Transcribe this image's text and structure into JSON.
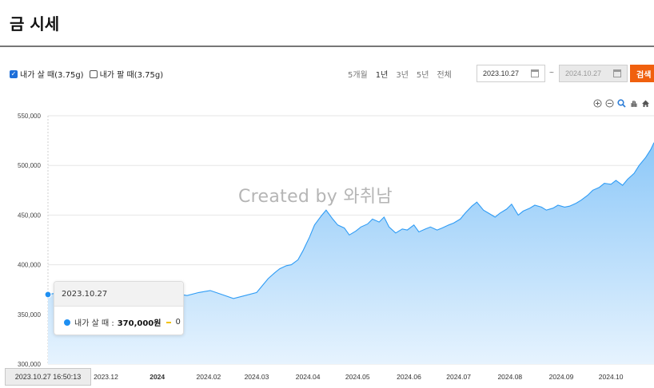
{
  "page": {
    "title": "금 시세"
  },
  "filters": {
    "buy_checkbox": {
      "label": "내가 살 때(3.75g)",
      "checked": true
    },
    "sell_checkbox": {
      "label": "내가 팔 때(3.75g)",
      "checked": false
    },
    "periods": [
      "5개월",
      "1년",
      "3년",
      "5년",
      "전체"
    ],
    "active_period": "1년",
    "start_date": "2023.10.27",
    "end_date": "2024.10.27",
    "tilde": "~",
    "search_label": "검색"
  },
  "toolbar_icons": [
    "zoom-in-icon",
    "zoom-out-icon",
    "magnify-icon",
    "pan-hand-icon",
    "home-icon"
  ],
  "watermark": "Created by 와취남",
  "tooltip": {
    "date": "2023.10.27",
    "series_label": "내가 살 때 :",
    "value": "370,000원",
    "secondary_value": "0"
  },
  "x_hover_label": "2023.10.27 16:50:13",
  "colors": {
    "line": "#2f9cf5",
    "area_top": "#8dc8f8",
    "area_bottom": "#e6f3fe",
    "accent": "#f0600e",
    "checkbox": "#1e6fd9"
  },
  "chart_data": {
    "type": "area",
    "title": "",
    "xlabel": "",
    "ylabel": "",
    "ylim": [
      300000,
      550000
    ],
    "y_ticks": [
      300000,
      350000,
      400000,
      450000,
      500000,
      550000
    ],
    "y_tick_labels": [
      "300,000",
      "350,000",
      "400,000",
      "450,000",
      "500,000",
      "550,000"
    ],
    "x_range": [
      "2023-10-27",
      "2024-10-27"
    ],
    "x_ticks": [
      {
        "date": "2023-12-01",
        "label": "2023.12",
        "bold": false
      },
      {
        "date": "2024-01-01",
        "label": "2024",
        "bold": true
      },
      {
        "date": "2024-02-01",
        "label": "2024.02",
        "bold": false
      },
      {
        "date": "2024-03-01",
        "label": "2024.03",
        "bold": false
      },
      {
        "date": "2024-04-01",
        "label": "2024.04",
        "bold": false
      },
      {
        "date": "2024-05-01",
        "label": "2024.05",
        "bold": false
      },
      {
        "date": "2024-06-01",
        "label": "2024.06",
        "bold": false
      },
      {
        "date": "2024-07-01",
        "label": "2024.07",
        "bold": false
      },
      {
        "date": "2024-08-01",
        "label": "2024.08",
        "bold": false
      },
      {
        "date": "2024-09-01",
        "label": "2024.09",
        "bold": false
      },
      {
        "date": "2024-10-01",
        "label": "2024.10",
        "bold": false
      }
    ],
    "grid": true,
    "series": [
      {
        "name": "내가 살 때",
        "x": [
          "2023-10-27",
          "2023-11-03",
          "2023-11-10",
          "2023-11-17",
          "2023-11-24",
          "2023-12-01",
          "2023-12-04",
          "2023-12-08",
          "2023-12-15",
          "2023-12-22",
          "2023-12-29",
          "2024-01-05",
          "2024-01-12",
          "2024-01-19",
          "2024-01-26",
          "2024-02-02",
          "2024-02-09",
          "2024-02-16",
          "2024-02-23",
          "2024-03-01",
          "2024-03-05",
          "2024-03-08",
          "2024-03-12",
          "2024-03-15",
          "2024-03-19",
          "2024-03-22",
          "2024-03-26",
          "2024-03-29",
          "2024-04-02",
          "2024-04-05",
          "2024-04-09",
          "2024-04-12",
          "2024-04-16",
          "2024-04-19",
          "2024-04-23",
          "2024-04-26",
          "2024-04-30",
          "2024-05-03",
          "2024-05-07",
          "2024-05-10",
          "2024-05-14",
          "2024-05-17",
          "2024-05-20",
          "2024-05-24",
          "2024-05-28",
          "2024-05-31",
          "2024-06-04",
          "2024-06-07",
          "2024-06-11",
          "2024-06-14",
          "2024-06-18",
          "2024-06-21",
          "2024-06-25",
          "2024-06-28",
          "2024-07-02",
          "2024-07-05",
          "2024-07-09",
          "2024-07-12",
          "2024-07-16",
          "2024-07-19",
          "2024-07-23",
          "2024-07-26",
          "2024-07-30",
          "2024-08-02",
          "2024-08-06",
          "2024-08-09",
          "2024-08-13",
          "2024-08-16",
          "2024-08-20",
          "2024-08-23",
          "2024-08-27",
          "2024-08-30",
          "2024-09-03",
          "2024-09-06",
          "2024-09-10",
          "2024-09-13",
          "2024-09-17",
          "2024-09-20",
          "2024-09-24",
          "2024-09-27",
          "2024-10-01",
          "2024-10-04",
          "2024-10-08",
          "2024-10-11",
          "2024-10-15",
          "2024-10-18",
          "2024-10-22",
          "2024-10-25",
          "2024-10-27"
        ],
        "values": [
          370000,
          372000,
          369000,
          371000,
          373000,
          376000,
          367000,
          370000,
          372000,
          370000,
          374000,
          370000,
          371000,
          369000,
          372000,
          374000,
          370000,
          366000,
          369000,
          372000,
          380000,
          386000,
          392000,
          396000,
          399000,
          400000,
          405000,
          414000,
          428000,
          440000,
          449000,
          455000,
          446000,
          440000,
          437000,
          430000,
          434000,
          438000,
          441000,
          446000,
          443000,
          448000,
          438000,
          432000,
          436000,
          435000,
          440000,
          433000,
          436000,
          438000,
          435000,
          437000,
          440000,
          442000,
          446000,
          452000,
          459000,
          463000,
          455000,
          452000,
          448000,
          452000,
          456000,
          461000,
          450000,
          454000,
          457000,
          460000,
          458000,
          455000,
          457000,
          460000,
          458000,
          459000,
          462000,
          465000,
          470000,
          475000,
          478000,
          482000,
          481000,
          485000,
          480000,
          486000,
          492000,
          500000,
          508000,
          516000,
          523000
        ]
      }
    ]
  }
}
